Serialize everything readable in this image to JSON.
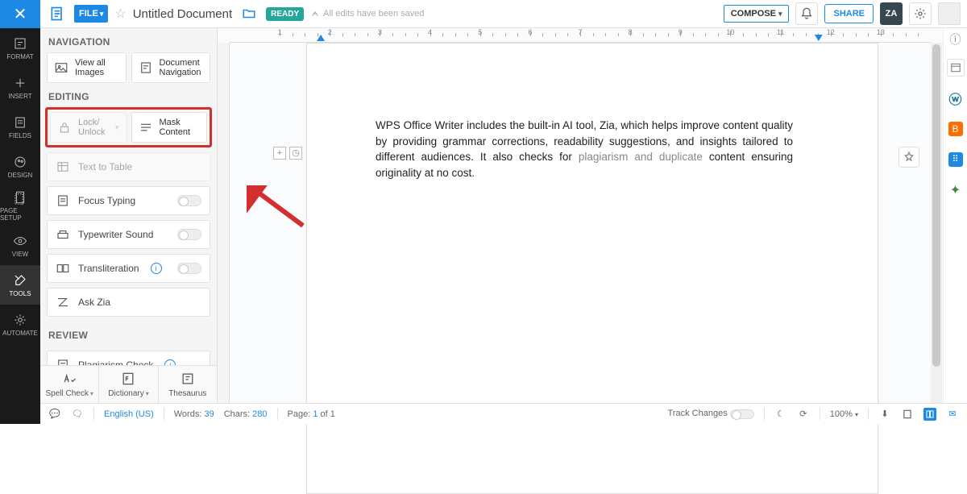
{
  "header": {
    "file_label": "FILE",
    "title": "Untitled Document",
    "status_badge": "READY",
    "saved_msg": "All edits have been saved",
    "compose": "COMPOSE",
    "share": "SHARE",
    "za": "ZA"
  },
  "rail": [
    {
      "label": "FORMAT"
    },
    {
      "label": "INSERT"
    },
    {
      "label": "FIELDS"
    },
    {
      "label": "DESIGN"
    },
    {
      "label": "PAGE SETUP"
    },
    {
      "label": "VIEW"
    },
    {
      "label": "TOOLS"
    },
    {
      "label": "AUTOMATE"
    }
  ],
  "panel": {
    "nav_header": "NAVIGATION",
    "view_images": "View all Images",
    "doc_nav": "Document Navigation",
    "edit_header": "EDITING",
    "lock": "Lock/ Unlock",
    "mask": "Mask Content",
    "text_to_table": "Text to Table",
    "focus": "Focus Typing",
    "sound": "Typewriter Sound",
    "translit": "Transliteration",
    "ask_zia": "Ask Zia",
    "review_header": "REVIEW",
    "plag": "Plagiarism Check",
    "spell": "Spell Check",
    "dict": "Dictionary",
    "thes": "Thesaurus"
  },
  "document": {
    "para_pre": "WPS Office Writer includes the built-in AI tool, Zia, which helps  improve content quality by providing grammar corrections, readability suggestions, and insights tailored to different audiences. It also checks for ",
    "plag_span": "plagiarism and duplicate",
    "para_post": " content ensuring originality at no cost."
  },
  "ruler": {
    "max": 14,
    "indent_left_pct": 13,
    "indent_right_pct": 84
  },
  "status": {
    "lang": "English (US)",
    "words_label": "Words:",
    "words": "39",
    "chars_label": "Chars:",
    "chars": "280",
    "page_label": "Page:",
    "page_cur": "1",
    "page_of": "of 1",
    "track": "Track Changes",
    "zoom": "100%"
  }
}
